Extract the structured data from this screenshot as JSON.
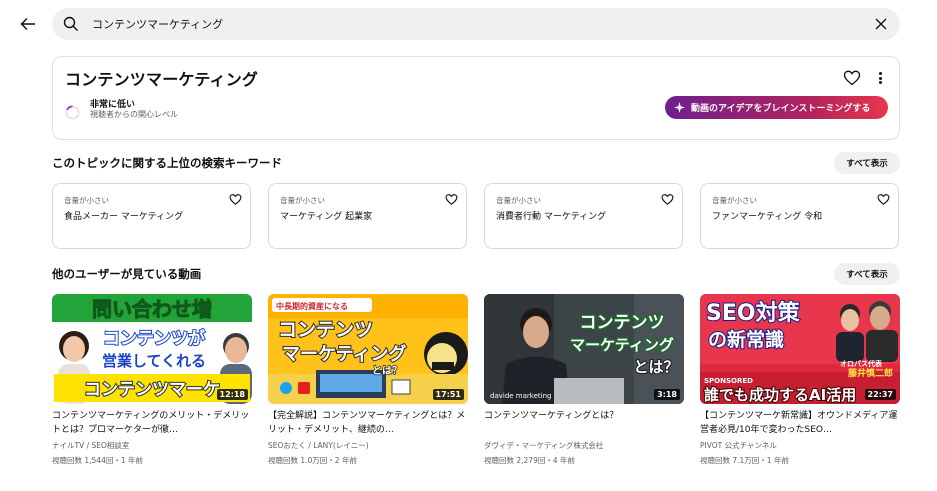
{
  "search": {
    "value": "コンテンツマーケティング",
    "placeholder": ""
  },
  "topic": {
    "title": "コンテンツマーケティング",
    "interest_level": "非常に低い",
    "interest_desc": "視聴者からの関心レベル",
    "brainstorm_label": "動画のアイデアをブレインストーミングする"
  },
  "keywords_section": {
    "title": "このトピックに関する上位の検索キーワード",
    "show_all": "すべて表示",
    "items": [
      {
        "volume": "音量が小さい",
        "keyword": "食品メーカー マーケティング"
      },
      {
        "volume": "音量が小さい",
        "keyword": "マーケティング 起業家"
      },
      {
        "volume": "音量が小さい",
        "keyword": "消費者行動 マーケティング"
      },
      {
        "volume": "音量が小さい",
        "keyword": "ファンマーケティング 令和"
      }
    ]
  },
  "videos_section": {
    "title": "他のユーザーが見ている動画",
    "show_all": "すべて表示",
    "items": [
      {
        "duration": "12:18",
        "title": "コンテンツマーケティングのメリット・デメリットとは？プロマーケターが徹…",
        "channel": "ナイルTV / SEO相談室",
        "stats": "視聴回数 1,544回・1 年前",
        "thumb_text": [
          "問い合わせ増",
          "コンテンツが",
          "営業してくれる",
          "コンテンツマーケ"
        ]
      },
      {
        "duration": "17:51",
        "title": "【完全解説】コンテンツマーケティングとは？メリット・デメリット、継続の…",
        "channel": "SEOおたく / LANY(レイニー)",
        "stats": "視聴回数 1.0万回・2 年前",
        "thumb_text": [
          "中長期的資産になる",
          "コンテンツ",
          "マーケティング",
          "とは？"
        ]
      },
      {
        "duration": "3:18",
        "title": "コンテンツマーケティングとは？",
        "channel": "ダヴィデ・マーケティング株式会社",
        "stats": "視聴回数 2,279回・4 年前",
        "thumb_text": [
          "コンテンツ",
          "マーケティング",
          "とは？",
          "davide marketing"
        ]
      },
      {
        "duration": "22:37",
        "title": "【コンテンツマーケ新常識】オウンドメディア運営者必見/10年で変わったSEO…",
        "channel": "PIVOT 公式チャンネル",
        "stats": "視聴回数 7.1万回・1 年前",
        "thumb_text": [
          "SEO対策",
          "の新常識",
          "SPONSORED",
          "誰でも成功するAI活用",
          "オロパス代表",
          "藤井慎二郎"
        ]
      }
    ]
  },
  "colors": {
    "brainstorm_start": "#6e1f8f",
    "brainstorm_end": "#e8364c",
    "chip_bg": "#f0f0f0"
  }
}
